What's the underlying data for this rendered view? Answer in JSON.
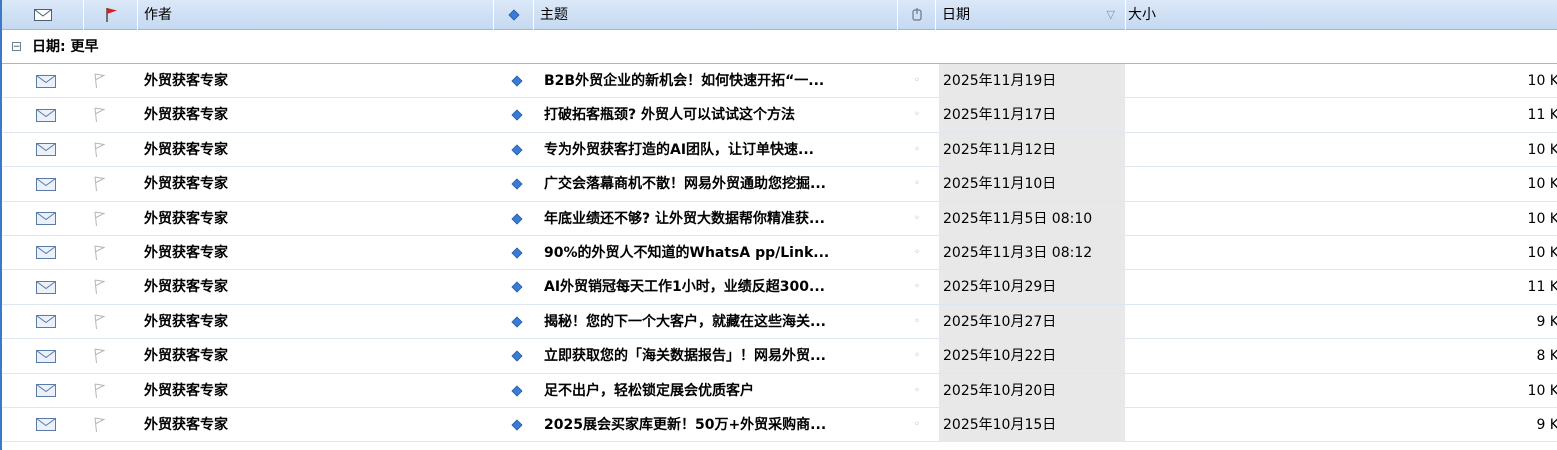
{
  "header": {
    "author": "作者",
    "subject": "主题",
    "date": "日期",
    "size": "大小",
    "sort_arrow": "▽"
  },
  "group": {
    "toggle": "−",
    "label": "日期: 更早"
  },
  "rows": [
    {
      "author": "外贸获客专家",
      "subject": "B2B外贸企业的新机会！如何快速开拓“一...",
      "date": "2025年11月19日",
      "size": "10 K"
    },
    {
      "author": "外贸获客专家",
      "subject": "打破拓客瓶颈? 外贸人可以试试这个方法",
      "date": "2025年11月17日",
      "size": "11 K"
    },
    {
      "author": "外贸获客专家",
      "subject": "专为外贸获客打造的AI团队，让订单快速...",
      "date": "2025年11月12日",
      "size": "10 K"
    },
    {
      "author": "外贸获客专家",
      "subject": "广交会落幕商机不散！网易外贸通助您挖掘...",
      "date": "2025年11月10日",
      "size": "10 K"
    },
    {
      "author": "外贸获客专家",
      "subject": "年底业绩还不够? 让外贸大数据帮你精准获...",
      "date": "2025年11月5日 08:10",
      "size": "10 K"
    },
    {
      "author": "外贸获客专家",
      "subject": "90%的外贸人不知道的WhatsA pp/Link...",
      "date": "2025年11月3日 08:12",
      "size": "10 K"
    },
    {
      "author": "外贸获客专家",
      "subject": "AI外贸销冠每天工作1小时，业绩反超300...",
      "date": "2025年10月29日",
      "size": "11 K"
    },
    {
      "author": "外贸获客专家",
      "subject": "揭秘！您的下一个大客户，就藏在这些海关...",
      "date": "2025年10月27日",
      "size": "9 K"
    },
    {
      "author": "外贸获客专家",
      "subject": "立即获取您的「海关数据报告」！网易外贸...",
      "date": "2025年10月22日",
      "size": "8 K"
    },
    {
      "author": "外贸获客专家",
      "subject": "足不出户，轻松锁定展会优质客户",
      "date": "2025年10月20日",
      "size": "10 K"
    },
    {
      "author": "外贸获客专家",
      "subject": "2025展会买家库更新！50万+外贸采购商...",
      "date": "2025年10月15日",
      "size": "9 K"
    }
  ],
  "colors": {
    "header_bg": "#c5d9f1",
    "date_column_bg": "#e8e8e8",
    "flag_red": "#d92020",
    "priority_blue": "#3a7bd5"
  },
  "icons": {
    "mail": "envelope-icon",
    "flag": "flag-icon",
    "priority": "priority-diamond-icon",
    "attachment": "attachment-icon"
  }
}
